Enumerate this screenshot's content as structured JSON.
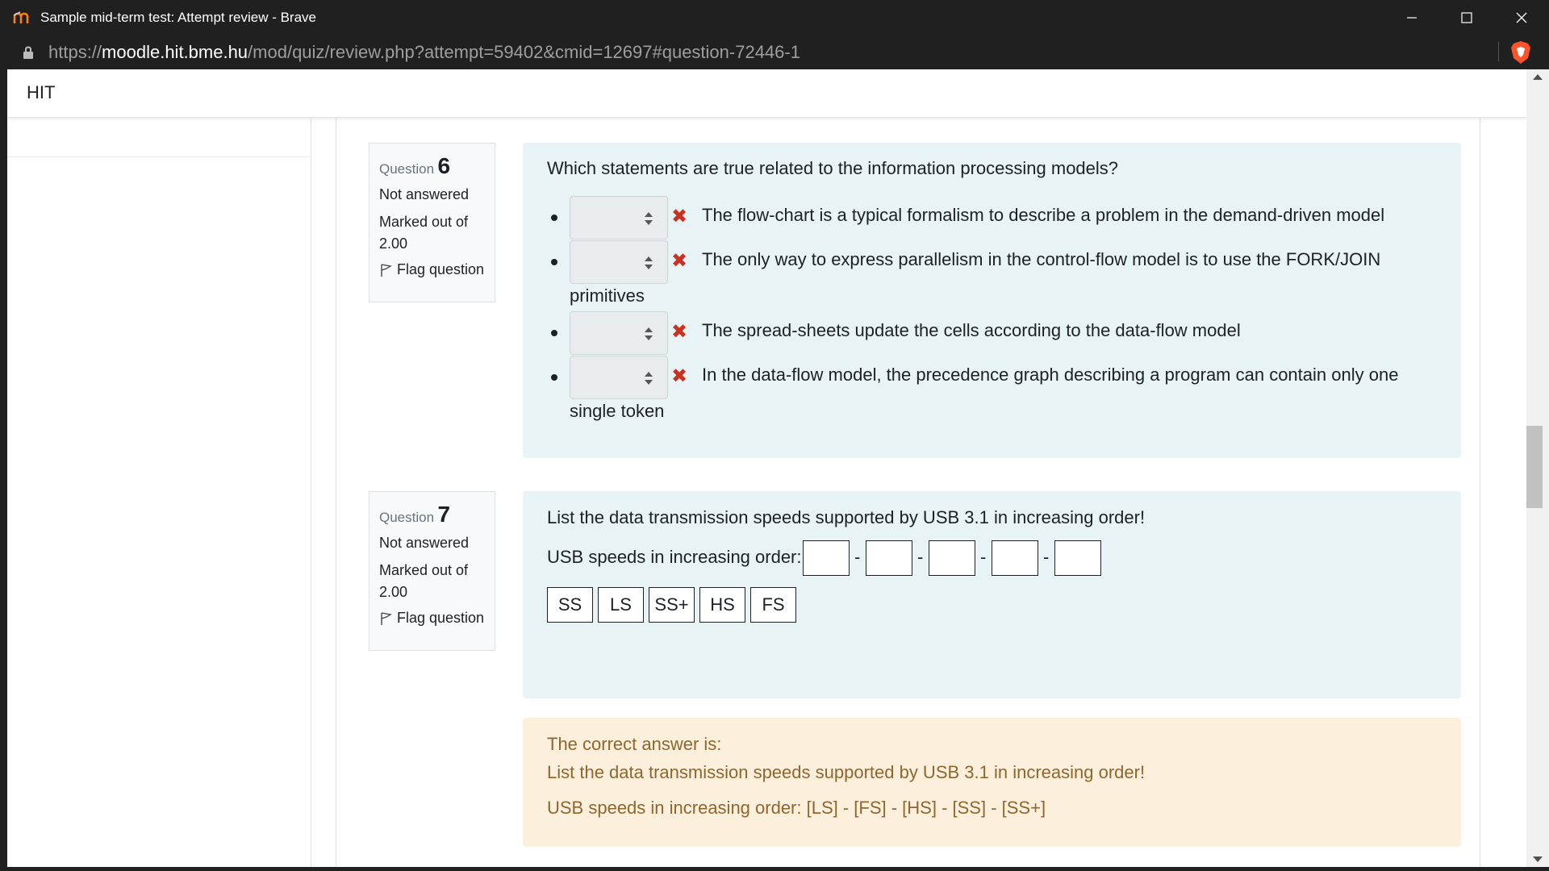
{
  "window": {
    "title": "Sample mid-term test: Attempt review - Brave"
  },
  "address": {
    "scheme": "https://",
    "host": "moodle.hit.bme.hu",
    "path": "/mod/quiz/review.php?attempt=59402&cmid=12697#question-72446-1"
  },
  "site": {
    "name": "HIT"
  },
  "questions": [
    {
      "label": "Question",
      "number": "6",
      "state": "Not answered",
      "grade_line1": "Marked out of",
      "grade_line2": "2.00",
      "flag": "Flag question",
      "text": "Which statements are true related to the information processing models?",
      "statements": [
        {
          "line1": "The flow-chart is a typical formalism to describe a problem in the demand-driven model",
          "line2": ""
        },
        {
          "line1": "The only way to express parallelism in the control-flow model is to use the FORK/JOIN",
          "line2": "primitives"
        },
        {
          "line1": "The spread-sheets update the cells according to the data-flow model",
          "line2": ""
        },
        {
          "line1": "In the data-flow model, the precedence graph describing a program can contain only one",
          "line2": "single token"
        }
      ]
    },
    {
      "label": "Question",
      "number": "7",
      "state": "Not answered",
      "grade_line1": "Marked out of",
      "grade_line2": "2.00",
      "flag": "Flag question",
      "text": "List the data transmission speeds supported by USB 3.1 in increasing order!",
      "prompt": "USB speeds in increasing order:",
      "separator": "-",
      "choices": [
        "SS",
        "LS",
        "SS+",
        "HS",
        "FS"
      ],
      "feedback": {
        "heading": "The correct answer is:",
        "question": "List the data transmission speeds supported by USB 3.1 in increasing order!",
        "answer": "USB speeds in increasing order: [LS] - [FS] - [HS] - [SS] - [SS+]"
      }
    }
  ],
  "colors": {
    "question_bg": "#e7f3f5",
    "feedback_bg": "#fcefdc",
    "feedback_text": "#8e662e",
    "incorrect": "#ca3120"
  }
}
